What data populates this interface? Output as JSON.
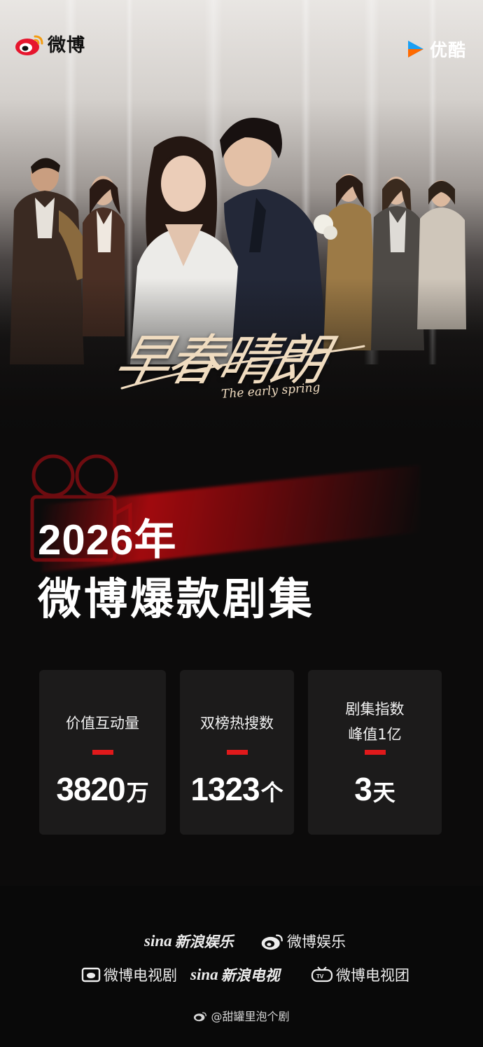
{
  "header": {
    "weibo_logo_text": "微博",
    "youku_logo_text": "优酷"
  },
  "drama": {
    "title_cn": "早春晴朗",
    "title_en": "The early spring"
  },
  "headline": {
    "year": "2026年",
    "main": "微博爆款剧集"
  },
  "stats": [
    {
      "label_lines": [
        "价值互动量"
      ],
      "value": "3820",
      "unit": "万"
    },
    {
      "label_lines": [
        "双榜热搜数"
      ],
      "value": "1323",
      "unit": "个"
    },
    {
      "label_lines": [
        "剧集指数",
        "峰值1亿"
      ],
      "value": "3",
      "unit": "天"
    }
  ],
  "footer": {
    "row1": [
      {
        "mark": "sina",
        "text": "新浪娱乐",
        "icon": "sina-icon"
      },
      {
        "mark": "",
        "text": "微博娱乐",
        "icon": "weibo-icon"
      }
    ],
    "row2": [
      {
        "mark": "",
        "text": "微博电视剧",
        "icon": "tv-screen-icon"
      },
      {
        "mark": "sina",
        "text": "新浪电视",
        "icon": "sina-icon"
      },
      {
        "mark": "",
        "text": "微博电视团",
        "icon": "tv-icon"
      }
    ],
    "credit": "@甜罐里泡个剧"
  },
  "colors": {
    "accent_red": "#e0191b",
    "card_bg": "#1c1b1b",
    "title_gold": "#f0dcc0"
  }
}
